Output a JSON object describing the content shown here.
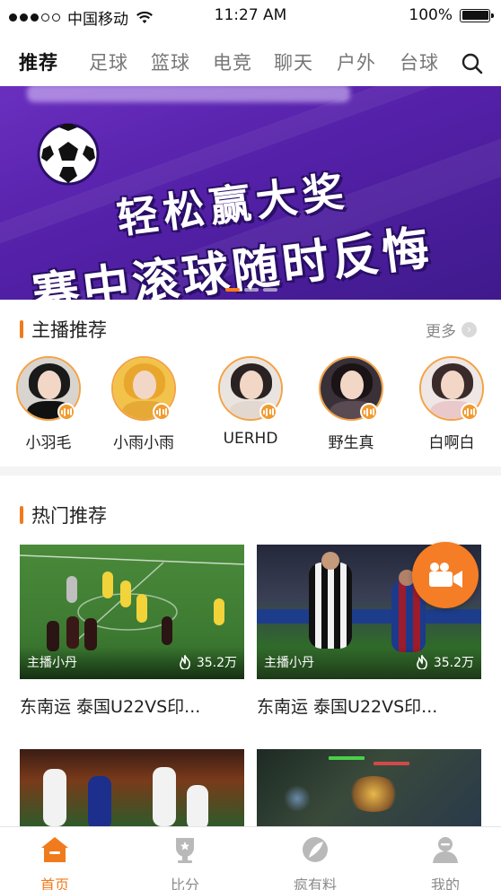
{
  "status_bar": {
    "carrier": "中国移动",
    "time": "11:27 AM",
    "battery": "100%"
  },
  "tabs": [
    {
      "label": "推荐",
      "active": true
    },
    {
      "label": "足球",
      "active": false
    },
    {
      "label": "篮球",
      "active": false
    },
    {
      "label": "电竞",
      "active": false
    },
    {
      "label": "聊天",
      "active": false
    },
    {
      "label": "户外",
      "active": false
    },
    {
      "label": "台球",
      "active": false
    }
  ],
  "banner": {
    "line1": "轻松赢大奖",
    "line2": "赛中滚球随时反悔",
    "pages": 3,
    "current_page": 1
  },
  "anchor_section": {
    "title": "主播推荐",
    "more_label": "更多",
    "streamers": [
      {
        "name": "小羽毛"
      },
      {
        "name": "小雨小雨"
      },
      {
        "name": "UERHD"
      },
      {
        "name": "野生真"
      },
      {
        "name": "白啊白"
      }
    ]
  },
  "hot_section": {
    "title": "热门推荐",
    "videos": [
      {
        "author": "主播小丹",
        "views": "35.2万",
        "title": "东南运 泰国U22VS印..."
      },
      {
        "author": "主播小丹",
        "views": "35.2万",
        "title": "东南运 泰国U22VS印..."
      },
      {
        "author": "",
        "views": "",
        "title": ""
      },
      {
        "author": "",
        "views": "",
        "title": ""
      }
    ]
  },
  "bottom_nav": [
    {
      "label": "首页",
      "icon": "home-icon",
      "active": true
    },
    {
      "label": "比分",
      "icon": "trophy-icon",
      "active": false
    },
    {
      "label": "疯有料",
      "icon": "leaf-icon",
      "active": false
    },
    {
      "label": "我的",
      "icon": "user-icon",
      "active": false
    }
  ],
  "colors": {
    "accent": "#f07b1d",
    "banner_purple": "#5420a8"
  }
}
